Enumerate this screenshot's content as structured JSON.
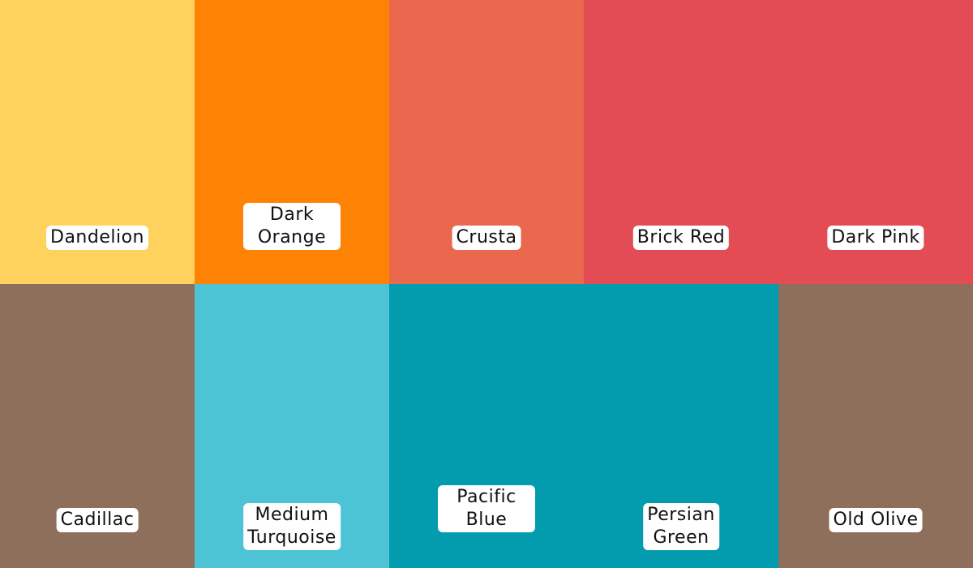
{
  "swatches": [
    {
      "name": "Dandelion",
      "label": "Dandelion",
      "color": "#FED25D"
    },
    {
      "name": "Dark Orange",
      "label": "Dark Orange",
      "color": "#FE8204"
    },
    {
      "name": "Crusta",
      "label": "Crusta",
      "color": "#E9684E"
    },
    {
      "name": "Brick Red",
      "label": "Brick Red",
      "color": "#E34B55"
    },
    {
      "name": "Dark Pink",
      "label": "Dark Pink",
      "color": "#E34B55"
    },
    {
      "name": "Cadillac",
      "label": "Cadillac",
      "color": "#8E6F5B"
    },
    {
      "name": "Medium Turquoise",
      "label": "Medium\nTurquoise",
      "color": "#4DC4D5"
    },
    {
      "name": "Pacific Blue",
      "label": "Pacific Blue",
      "color": "#039BAE"
    },
    {
      "name": "Persian Green",
      "label": "Persian\nGreen",
      "color": "#039BAE"
    },
    {
      "name": "Old Olive",
      "label": "Old Olive",
      "color": "#8E6F5B"
    }
  ]
}
